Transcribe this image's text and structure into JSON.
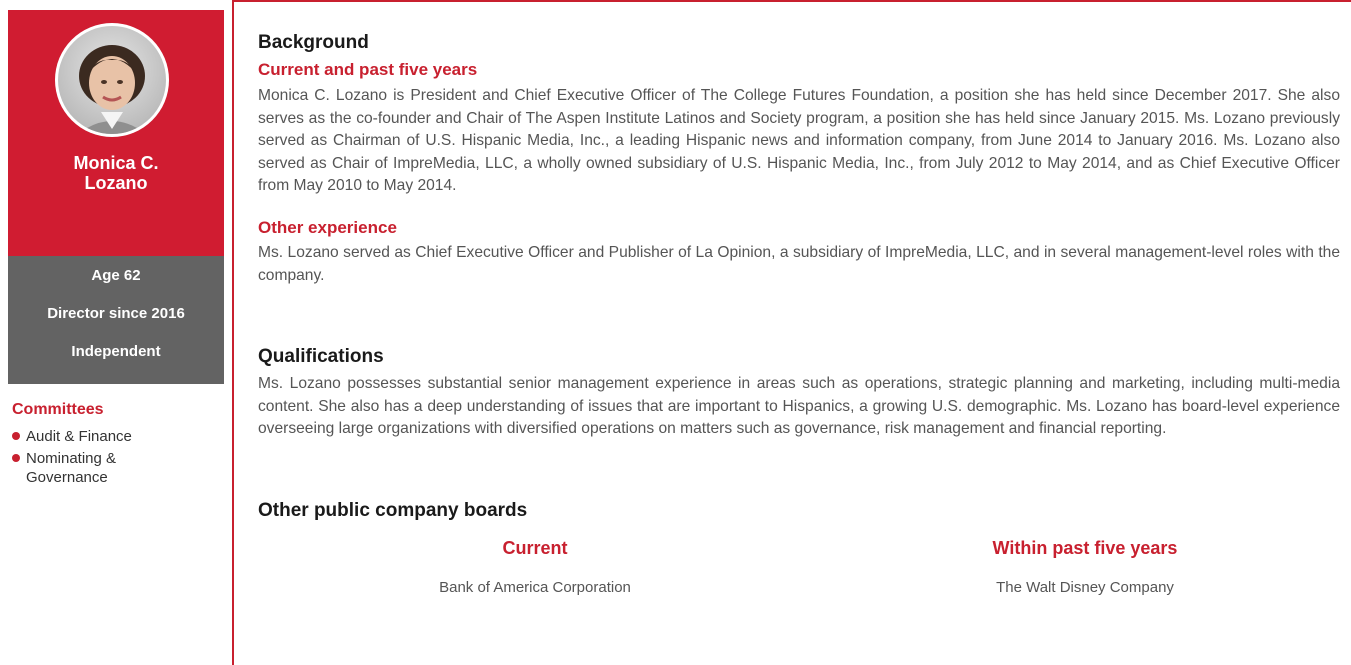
{
  "profile": {
    "name_line1": "Monica C.",
    "name_line2": "Lozano",
    "age": "Age 62",
    "director_since": "Director since 2016",
    "status": "Independent",
    "committees_title": "Committees",
    "committees": [
      "Audit & Finance",
      "Nominating &",
      "Governance"
    ]
  },
  "background": {
    "heading": "Background",
    "current_heading": "Current and past five years",
    "current_text": "Monica C. Lozano is President and Chief Executive Officer of The College Futures Foundation, a position she has held since December 2017. She also serves as the co-founder and Chair of The Aspen Institute Latinos and Society program, a position she has held since January 2015. Ms. Lozano previously served as Chairman of U.S. Hispanic Media, Inc., a leading Hispanic news and information company, from June 2014 to January 2016. Ms. Lozano also served as Chair of ImpreMedia, LLC, a wholly owned subsidiary of U.S. Hispanic Media, Inc., from July 2012 to May 2014, and as Chief Executive Officer from May 2010 to May 2014.",
    "other_heading": "Other experience",
    "other_text": "Ms. Lozano served as Chief Executive Officer and Publisher of La Opinion, a subsidiary of ImpreMedia, LLC, and in several management-level roles with the company."
  },
  "qualifications": {
    "heading": "Qualifications",
    "text": "Ms. Lozano possesses substantial senior management experience in areas such as operations, strategic planning and marketing, including multi-media content. She also has a deep understanding of issues that are important to Hispanics, a growing U.S. demographic. Ms. Lozano has board-level experience overseeing large organizations with diversified operations on matters such as governance, risk management and financial reporting."
  },
  "boards": {
    "heading": "Other public company boards",
    "current_heading": "Current",
    "current_item": "Bank of America Corporation",
    "past_heading": "Within past five years",
    "past_item": "The Walt Disney Company"
  },
  "colors": {
    "accent": "#c8202f",
    "panel_gray": "#636363"
  }
}
